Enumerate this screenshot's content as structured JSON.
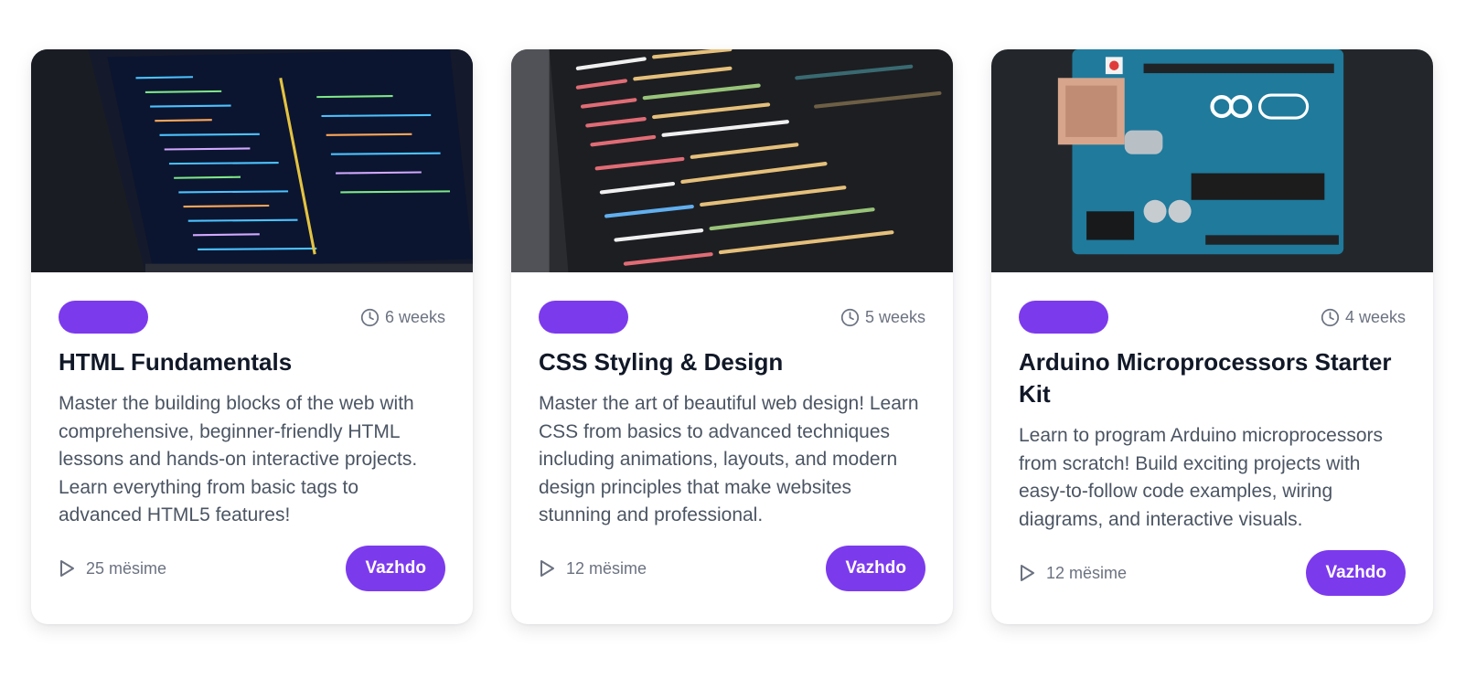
{
  "courses": [
    {
      "image": "laptop-code-photo",
      "duration": "6 weeks",
      "title": "HTML Fundamentals",
      "description": "Master the building blocks of the web with comprehensive, beginner-friendly HTML lessons and hands-on interactive projects. Learn everything from basic tags to advanced HTML5 features!",
      "lessons": "25 mësime",
      "button": "Vazhdo"
    },
    {
      "image": "monitor-code-photo",
      "duration": "5 weeks",
      "title": "CSS Styling & Design",
      "description": "Master the art of beautiful web design! Learn CSS from basics to advanced techniques including animations, layouts, and modern design principles that make websites stunning and professional.",
      "lessons": "12 mësime",
      "button": "Vazhdo"
    },
    {
      "image": "arduino-board-photo",
      "duration": "4 weeks",
      "title": "Arduino Microprocessors Starter Kit",
      "description": "Learn to program Arduino microprocessors from scratch! Build exciting projects with easy-to-follow code examples, wiring diagrams, and interactive visuals.",
      "lessons": "12 mësime",
      "button": "Vazhdo"
    }
  ],
  "colors": {
    "accent": "#7c3aed",
    "title": "#111827",
    "text": "#4b5563",
    "muted": "#6b7280"
  },
  "icons": {
    "duration": "clock-icon",
    "lessons": "play-icon"
  }
}
